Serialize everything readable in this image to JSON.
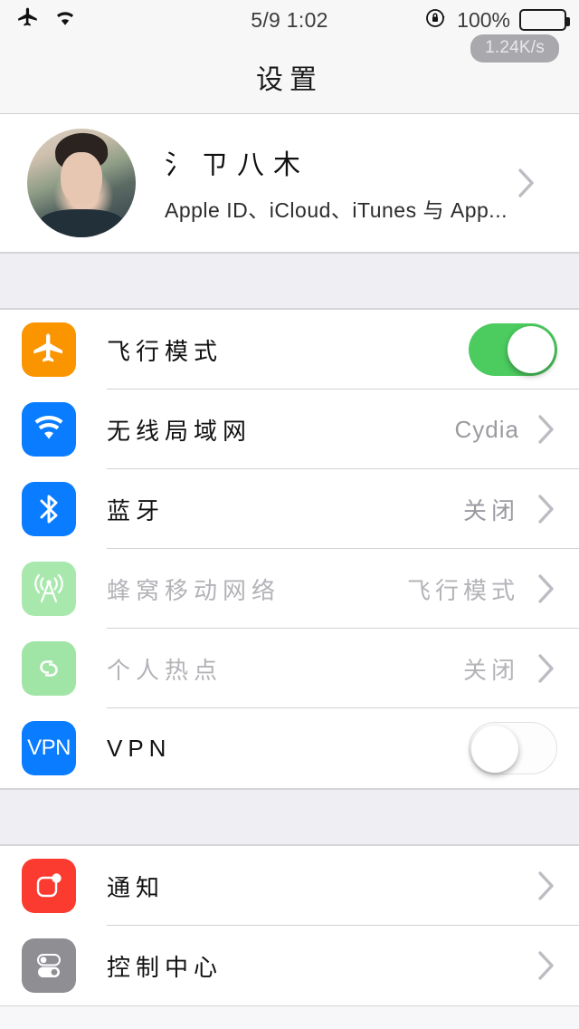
{
  "status_bar": {
    "airplane_icon": "airplane-icon",
    "wifi_icon": "wifi-icon",
    "time": "5/9 1:02",
    "rotation_lock_icon": "rotation-lock-icon",
    "battery_percent": "100%",
    "battery_icon": "battery-full-icon",
    "network_speed": "1.24K/s"
  },
  "navbar": {
    "title": "设置"
  },
  "profile": {
    "name": "氵ㄗ八木",
    "subtitle": "Apple ID、iCloud、iTunes 与 App...",
    "avatar_name": "user-avatar",
    "chevron": "chevron-right-icon"
  },
  "colors": {
    "airplane": "#fa9500",
    "wifi": "#0a7cff",
    "bluetooth": "#0a7cff",
    "cellular_disabled": "#a9e8ad",
    "hotspot_disabled": "#a0e5a6",
    "vpn": "#0a7cff",
    "notifications": "#fb3b30",
    "control_center": "#8e8e93",
    "toggle_on": "#4ccb5f",
    "separator": "#d2d2d6",
    "section_gap": "#eeeef3"
  },
  "sections": [
    {
      "name": "connectivity",
      "rows": [
        {
          "key": "airplane_mode",
          "icon": "airplane-icon",
          "label": "飞行模式",
          "control": "toggle",
          "toggle_state": "on",
          "value": "",
          "disabled": false
        },
        {
          "key": "wifi",
          "icon": "wifi-icon",
          "label": "无线局域网",
          "control": "chevron",
          "value": "Cydia",
          "value_latin": true,
          "disabled": false
        },
        {
          "key": "bluetooth",
          "icon": "bluetooth-icon",
          "label": "蓝牙",
          "control": "chevron",
          "value": "关闭",
          "disabled": false
        },
        {
          "key": "cellular",
          "icon": "cellular-icon",
          "label": "蜂窝移动网络",
          "control": "chevron",
          "value": "飞行模式",
          "disabled": true
        },
        {
          "key": "hotspot",
          "icon": "hotspot-icon",
          "label": "个人热点",
          "control": "chevron",
          "value": "关闭",
          "disabled": true
        },
        {
          "key": "vpn",
          "icon": "vpn-icon",
          "label": "VPN",
          "control": "toggle",
          "toggle_state": "off",
          "value": "",
          "disabled": false
        }
      ]
    },
    {
      "name": "system",
      "rows": [
        {
          "key": "notifications",
          "icon": "notifications-icon",
          "label": "通知",
          "control": "chevron",
          "value": "",
          "disabled": false
        },
        {
          "key": "control_center",
          "icon": "control-center-icon",
          "label": "控制中心",
          "control": "chevron",
          "value": "",
          "disabled": false
        }
      ]
    }
  ]
}
